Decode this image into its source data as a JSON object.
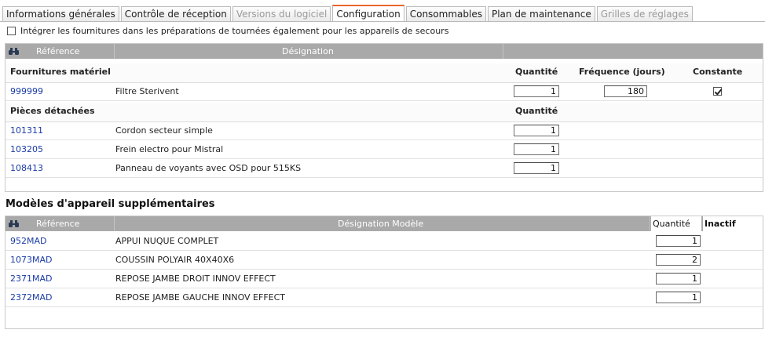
{
  "tabs": [
    {
      "label": "Informations générales",
      "state": "normal"
    },
    {
      "label": "Contrôle de réception",
      "state": "normal"
    },
    {
      "label": "Versions du logiciel",
      "state": "disabled"
    },
    {
      "label": "Configuration",
      "state": "active"
    },
    {
      "label": "Consommables",
      "state": "normal"
    },
    {
      "label": "Plan de maintenance",
      "state": "normal"
    },
    {
      "label": "Grilles de réglages",
      "state": "disabled"
    }
  ],
  "emergency_checkbox": {
    "label": "Intégrer les fournitures dans les préparations de tournées également pour les appareils de secours",
    "checked": false
  },
  "supplies_grid": {
    "header": {
      "reference": "Référence",
      "designation": "Désignation"
    },
    "materiel": {
      "title": "Fournitures matériel",
      "col_quantity": "Quantité",
      "col_frequency": "Fréquence (jours)",
      "col_constant": "Constante",
      "rows": [
        {
          "reference": "999999",
          "designation": "Filtre Sterivent",
          "quantity": "1",
          "frequency": "180",
          "constant": true
        }
      ]
    },
    "pieces": {
      "title": "Pièces détachées",
      "col_quantity": "Quantité",
      "rows": [
        {
          "reference": "101311",
          "designation": "Cordon secteur simple",
          "quantity": "1"
        },
        {
          "reference": "103205",
          "designation": "Frein electro pour Mistral",
          "quantity": "1"
        },
        {
          "reference": "108413",
          "designation": "Panneau de voyants avec OSD pour 515KS",
          "quantity": "1"
        }
      ]
    }
  },
  "models_section": {
    "title": "Modèles d'appareil supplémentaires",
    "header": {
      "reference": "Référence",
      "designation": "Désignation Modèle",
      "quantity": "Quantité",
      "inactive": "Inactif"
    },
    "rows": [
      {
        "reference": "952MAD",
        "designation": "APPUI NUQUE COMPLET",
        "quantity": "1"
      },
      {
        "reference": "1073MAD",
        "designation": "COUSSIN POLYAIR 40X40X6",
        "quantity": "2"
      },
      {
        "reference": "2371MAD",
        "designation": "REPOSE JAMBE DROIT INNOV EFFECT",
        "quantity": "1"
      },
      {
        "reference": "2372MAD",
        "designation": "REPOSE JAMBE GAUCHE INNOV EFFECT",
        "quantity": "1"
      }
    ]
  },
  "icons": {
    "grid_header": "binoculars-icon"
  },
  "colors": {
    "active_tab_accent": "#e8662c",
    "grid_header_bg": "#a9a9a9",
    "link": "#1a3ca8"
  }
}
